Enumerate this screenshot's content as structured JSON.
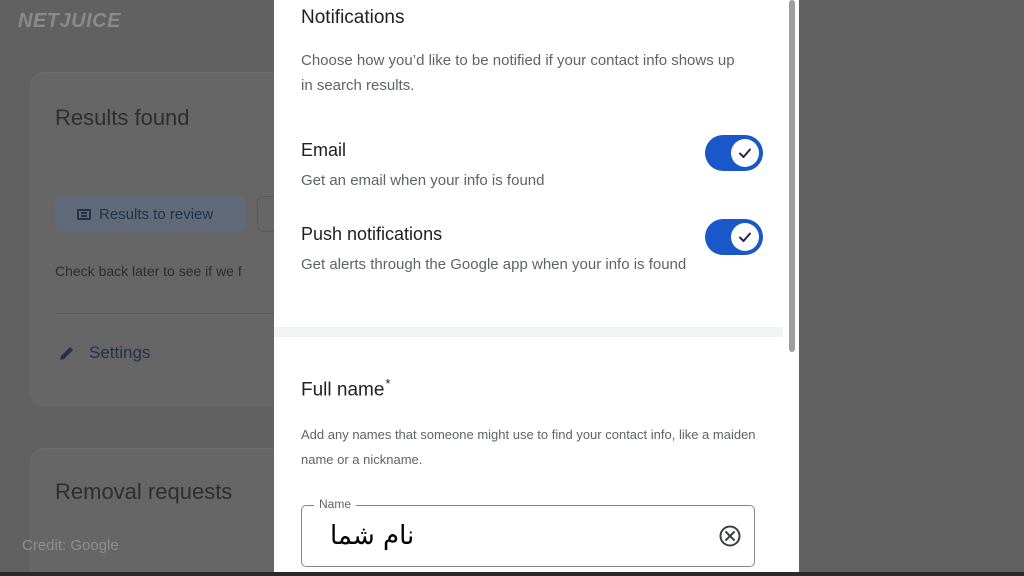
{
  "watermark": {
    "brand": "NETJUICE",
    "credit": "Credit: Google"
  },
  "background": {
    "results_title": "Results found",
    "results_chip_label": "Results to review",
    "results_text": "Check back later to see if we f",
    "settings_label": "Settings",
    "removal_title": "Removal requests"
  },
  "dialog": {
    "notifications": {
      "title": "Notifications",
      "description": "Choose how you’d like to be notified if your contact info shows up in search results.",
      "email": {
        "label": "Email",
        "description": "Get an email when your info is found",
        "enabled": true
      },
      "push": {
        "label": "Push notifications",
        "description": "Get alerts through the Google app when your info is found",
        "enabled": true
      }
    },
    "full_name": {
      "title": "Full name",
      "required_mark": "*",
      "description": "Add any names that someone might use to find your contact info, like a maiden name or a nickname.",
      "field_label": "Name",
      "field_value": "نام شما"
    }
  },
  "icons": {
    "toggle_knob": "check-icon",
    "clear": "clear-circle-icon",
    "settings": "pencil-icon",
    "chip": "list-icon"
  },
  "colors": {
    "accent": "#1a57c9",
    "overlay": "#616161"
  }
}
